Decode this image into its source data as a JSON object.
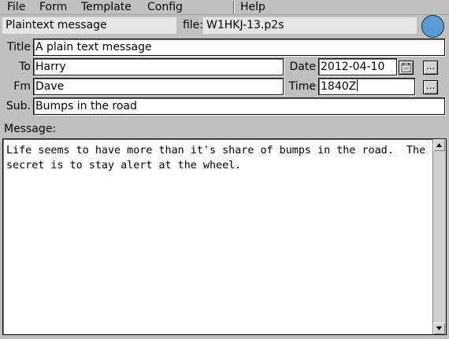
{
  "menu": {
    "file": "File",
    "form": "Form",
    "template": "Template",
    "config": "Config",
    "help": "Help"
  },
  "header": {
    "form_type": "Plaintext message",
    "file_label": "file:",
    "file_name": "W1HKJ-13.p2s",
    "status_color": "#5b9bd5"
  },
  "fields": {
    "title_label": "Title",
    "title_value": "A plain text message",
    "to_label": "To",
    "to_value": "Harry",
    "date_label": "Date",
    "date_value": "2012-04-10",
    "fm_label": "Fm",
    "fm_value": "Dave",
    "time_label": "Time",
    "time_value": "1840Z",
    "sub_label": "Sub.",
    "sub_value": "Bumps in the road",
    "ellipsis": "..."
  },
  "message": {
    "label": "Message:",
    "text": "Life seems to have more than it's share of bumps in the road.  The\nsecret is to stay alert at the wheel."
  },
  "icons": {
    "calendar": "calendar-icon",
    "scroll_up": "arrow-up-icon",
    "scroll_down": "arrow-down-icon"
  }
}
